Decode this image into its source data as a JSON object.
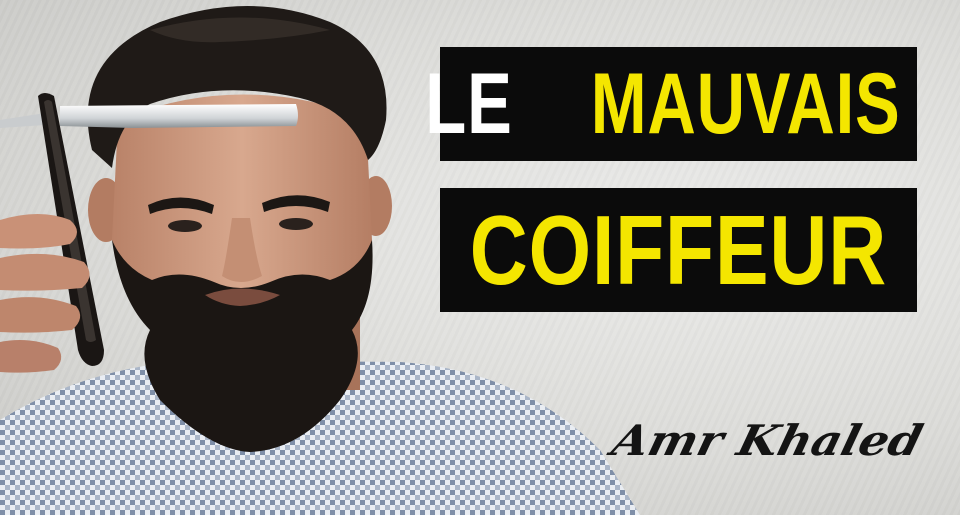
{
  "title": {
    "line1_part1": "LE",
    "line1_part2": "MAUVAIS",
    "line2": "COIFFEUR"
  },
  "signature": "Amr Khaled",
  "colors": {
    "banner_background": "#0b0b0b",
    "accent_yellow": "#f4e600",
    "white_text": "#ffffff",
    "wall": "#dcdcd9"
  },
  "icons": [
    "straight-razor-icon"
  ]
}
